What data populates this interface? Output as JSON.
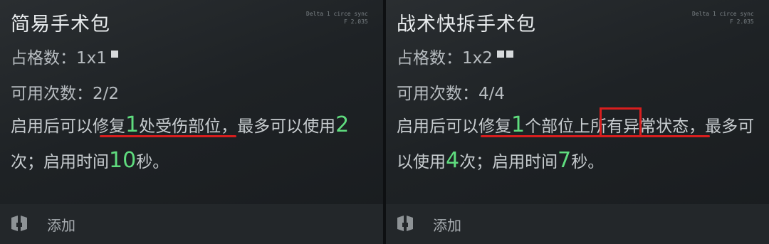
{
  "cards": [
    {
      "title": "简易手术包",
      "size_label": "占格数：",
      "size_value": "1x1",
      "size_cells": 1,
      "uses_label": "可用次数：",
      "uses_value": "2/2",
      "desc": {
        "p1": "启用后可以修复",
        "n1": "1",
        "p2": "处受伤部位，最多可以使用",
        "n2": "2",
        "p3": "次；启用时间",
        "n3": "10",
        "p4": "秒。"
      },
      "hud": {
        "l1": "Delta 1  circe sync",
        "l2": "F    2.035"
      },
      "add_label": "添加"
    },
    {
      "title": "战术快拆手术包",
      "size_label": "占格数：",
      "size_value": "1x2",
      "size_cells": 2,
      "uses_label": "可用次数：",
      "uses_value": "4/4",
      "desc": {
        "p1": "启用后可以修复",
        "n1": "1",
        "p2": "个部位上",
        "boxed": "所有",
        "p3": "异常状态，最多可以使用",
        "n2": "4",
        "p4": "次；启用时间",
        "n3": "7",
        "p5": "秒。"
      },
      "hud": {
        "l1": "Delta 1  circe sync",
        "l2": "F    2.035"
      },
      "add_label": "添加"
    }
  ],
  "colors": {
    "highlight_number": "#5fdc7e",
    "annotation_red": "#d91e1e"
  }
}
